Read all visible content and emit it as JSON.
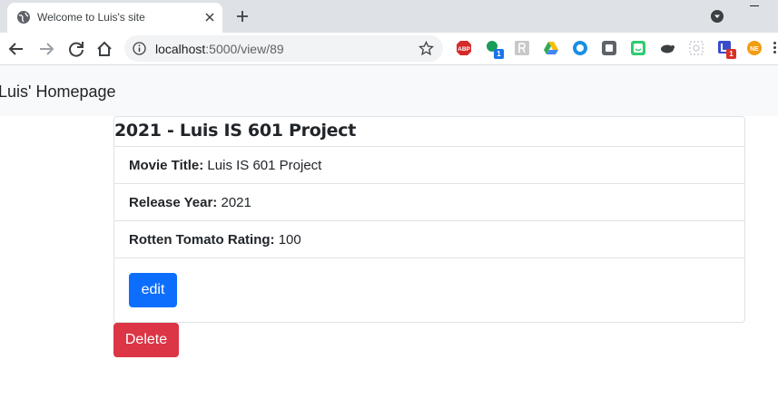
{
  "browser": {
    "tab_title": "Welcome to Luis's site",
    "url_host": "localhost",
    "url_path": ":5000/view/89",
    "extensions": [
      {
        "name": "adblock-plus-icon",
        "label": "ABP"
      },
      {
        "name": "green-extension-icon",
        "badge": "1"
      },
      {
        "name": "reader-extension-icon"
      },
      {
        "name": "google-drive-icon"
      },
      {
        "name": "circle-extension-icon"
      },
      {
        "name": "gray-square-extension-icon"
      },
      {
        "name": "green-face-extension-icon"
      },
      {
        "name": "turtle-extension-icon"
      },
      {
        "name": "dashed-box-extension-icon"
      },
      {
        "name": "blue-extension-icon",
        "badge": "1"
      },
      {
        "name": "orange-extension-icon",
        "label": "NE"
      }
    ]
  },
  "navbar": {
    "brand": "Luis' Homepage"
  },
  "card": {
    "title": "2021 - Luis IS 601 Project",
    "fields": [
      {
        "label": "Movie Title:",
        "value": "Luis IS 601 Project"
      },
      {
        "label": "Release Year:",
        "value": "2021"
      },
      {
        "label": "Rotten Tomato Rating:",
        "value": "100"
      }
    ],
    "edit_label": "edit"
  },
  "delete_label": "Delete",
  "colors": {
    "primary": "#0d6efd",
    "danger": "#dc3545",
    "navbar_bg": "#f8f9fa"
  }
}
